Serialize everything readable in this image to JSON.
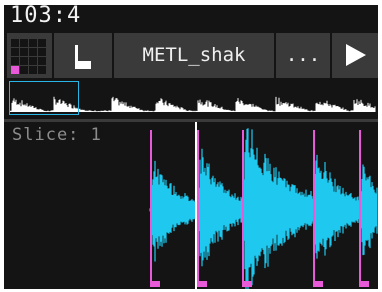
{
  "header": {
    "bpm": "103:4"
  },
  "toolbar": {
    "grid_icon": "grid-icon",
    "note_icon": "note-icon",
    "sample_name": "METL_shak",
    "more_label": "...",
    "play_icon": "play-icon"
  },
  "waveform": {
    "slice_label": "Slice: 1"
  },
  "colors": {
    "background": "#141414",
    "button": "#3a3a3a",
    "waveform": "#1ec8ee",
    "slice_marker": "#e85ad8",
    "playhead": "#ffffff",
    "overview_window": "#29b6e6",
    "text": "#f2f2f2",
    "label_text": "#8c8c8c"
  }
}
